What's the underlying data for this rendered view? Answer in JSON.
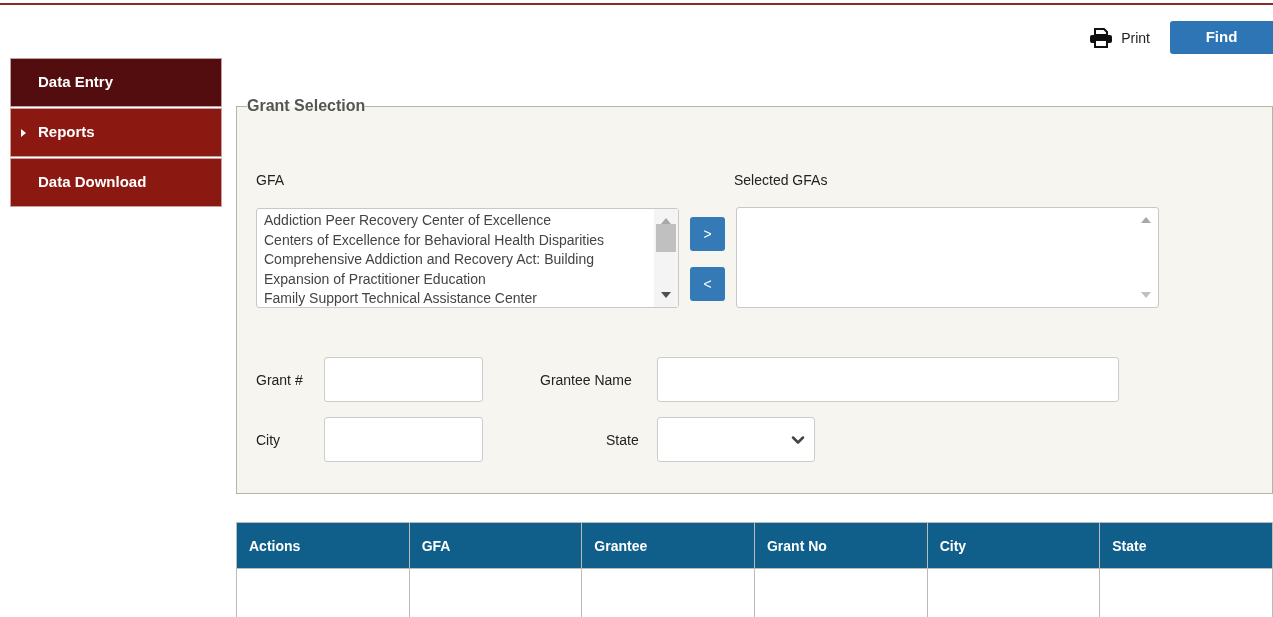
{
  "toolbar": {
    "print": "Print",
    "find": "Find"
  },
  "sidebar": {
    "items": [
      {
        "label": "Data Entry",
        "selected": true,
        "has_submenu": false
      },
      {
        "label": "Reports",
        "selected": false,
        "has_submenu": true
      },
      {
        "label": "Data Download",
        "selected": false,
        "has_submenu": false
      }
    ]
  },
  "grant_selection": {
    "legend": "Grant Selection",
    "gfa_label": "GFA",
    "selected_label": "Selected GFAs",
    "gfa_options": [
      "Addiction Peer Recovery Center of Excellence",
      "Centers of Excellence for Behavioral Health Disparities",
      "Comprehensive Addiction and Recovery Act: Building",
      "Expansion of Practitioner Education",
      "Family Support Technical Assistance Center"
    ],
    "add_button": ">",
    "remove_button": "<",
    "grant_no_label": "Grant #",
    "grantee_label": "Grantee Name",
    "city_label": "City",
    "state_label": "State"
  },
  "table": {
    "columns": [
      "Actions",
      "GFA",
      "Grantee",
      "Grant No",
      "City",
      "State"
    ]
  }
}
